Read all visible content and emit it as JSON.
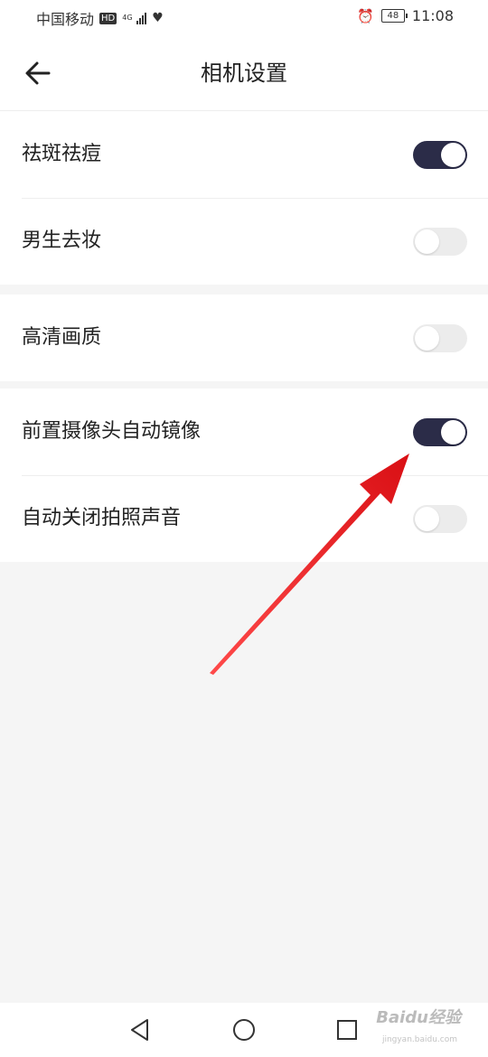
{
  "status_bar": {
    "carrier": "中国移动",
    "hd": "HD",
    "network": "4G",
    "battery": "48",
    "time": "11:08"
  },
  "header": {
    "title": "相机设置",
    "back_icon": "arrow-left-icon"
  },
  "settings": [
    {
      "label": "祛斑祛痘",
      "on": true
    },
    {
      "label": "男生去妆",
      "on": false
    },
    {
      "label": "高清画质",
      "on": false
    },
    {
      "label": "前置摄像头自动镜像",
      "on": true
    },
    {
      "label": "自动关闭拍照声音",
      "on": false
    }
  ],
  "colors": {
    "toggle_on": "#2b2c48",
    "toggle_off": "#ececec",
    "annotation_arrow": "#e8141a"
  },
  "nav_bar": {
    "icons": [
      "back-triangle-icon",
      "home-circle-icon",
      "recents-square-icon"
    ]
  },
  "watermark": {
    "brand": "Baidu经验",
    "url": "jingyan.baidu.com"
  }
}
